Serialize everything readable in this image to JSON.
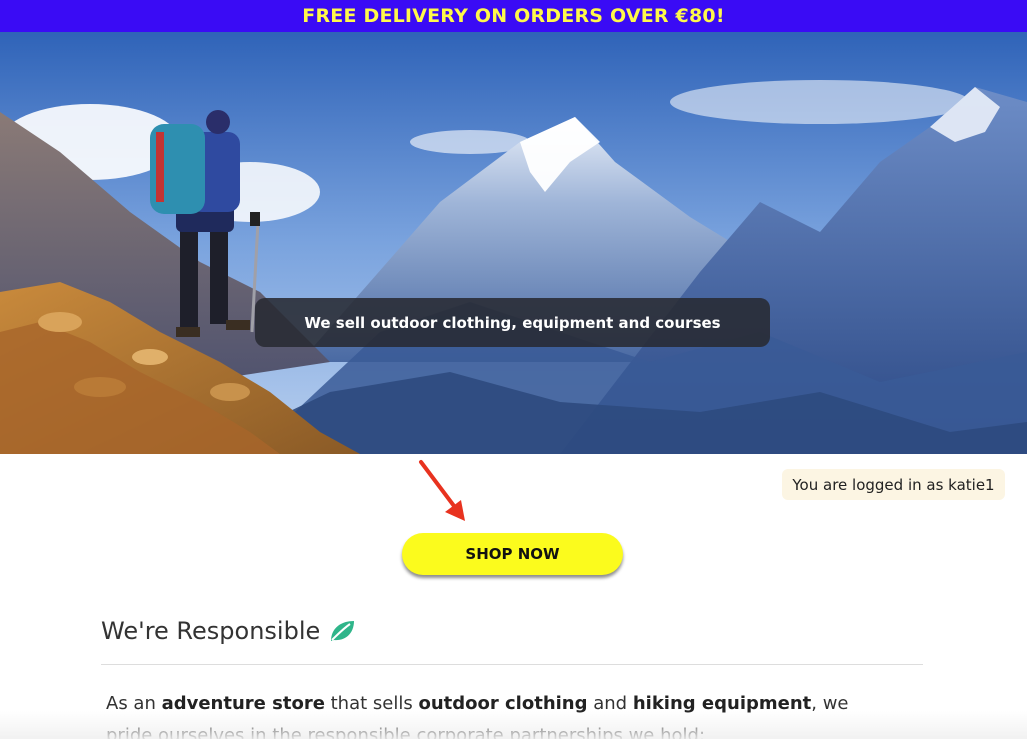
{
  "promo": {
    "text": "FREE DELIVERY ON ORDERS OVER €80!"
  },
  "hero": {
    "caption": "We sell outdoor clothing, equipment and courses"
  },
  "account": {
    "status": "You are logged in as katie1"
  },
  "cta": {
    "label": "SHOP NOW"
  },
  "section": {
    "title": "We're Responsible",
    "icon": "leaf-icon",
    "paragraph": {
      "t1": "As an ",
      "b1": "adventure store",
      "t2": " that sells ",
      "b2": "outdoor clothing",
      "t3": " and ",
      "b3": "hiking equipment",
      "t4": ", we pride ourselves in the responsible corporate partnerships we hold:"
    }
  },
  "colors": {
    "banner_bg": "#3a0bf5",
    "banner_text": "#fff94a",
    "button_bg": "#fbfb1d",
    "leaf": "#2fb58a",
    "arrow": "#e8321f"
  }
}
